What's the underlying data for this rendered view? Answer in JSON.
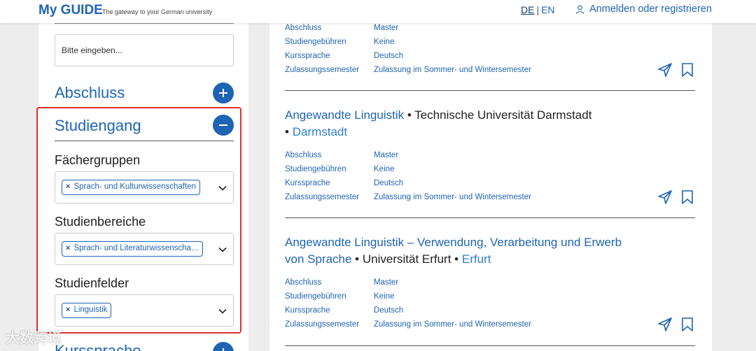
{
  "header": {
    "logo": "My GUIDE",
    "tagline": "The gateway to your German university",
    "lang_de": "DE",
    "lang_sep": "|",
    "lang_en": "EN",
    "login": "Anmelden oder registrieren"
  },
  "sidebar": {
    "search_placeholder": "Bitte eingeben...",
    "abschluss_title": "Abschluss",
    "studiengang_title": "Studiengang",
    "faechergruppen_label": "Fächergruppen",
    "faechergruppen_chip": "Sprach- und Kulturwissenschaften",
    "studienbereiche_label": "Studienbereiche",
    "studienbereiche_chip": "Sprach- und Literaturwissenscha…",
    "studienfelder_label": "Studienfelder",
    "studienfelder_chip": "Linguistik",
    "kurssprache_title": "Kurssprache",
    "chip_remove": "×"
  },
  "results": {
    "attr_labels": {
      "abschluss": "Abschluss",
      "gebuehren": "Studiengebühren",
      "sprache": "Kurssprache",
      "semester": "Zulassungssemester"
    },
    "items": [
      {
        "abschluss": "Master",
        "gebuehren": "Keine",
        "sprache": "Deutsch",
        "semester": "Zulassung im Sommer- und Wintersemester"
      },
      {
        "name": "Angewandte Linguistik",
        "sep1": " • ",
        "university": "Technische Universität Darmstadt",
        "sep2": "• ",
        "city": "Darmstadt",
        "abschluss": "Master",
        "gebuehren": "Keine",
        "sprache": "Deutsch",
        "semester": "Zulassung im Sommer- und Wintersemester"
      },
      {
        "name_line1": "Angewandte Linguistik – Verwendung, Verarbeitung und Erwerb",
        "name_line2": "von Sprache",
        "sep1": " • ",
        "university": "Universität Erfurt",
        "sep2": " • ",
        "city": "Erfurt",
        "abschluss": "Master",
        "gebuehren": "Keine",
        "sprache": "Deutsch",
        "semester": "Zulassung im Sommer- und Wintersemester"
      }
    ]
  },
  "watermark": "大数跨境",
  "colors": {
    "brand_blue": "#1e64b4",
    "highlight_red": "#e0302c"
  }
}
